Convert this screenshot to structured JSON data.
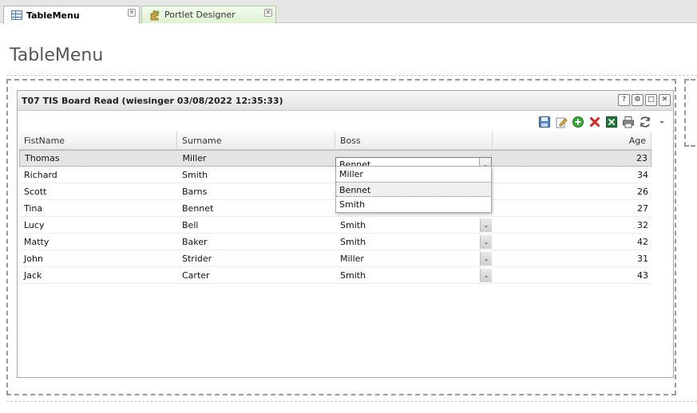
{
  "tabs": [
    {
      "label": "TableMenu",
      "active": true,
      "icon": "table-icon"
    },
    {
      "label": "Portlet Designer",
      "active": false,
      "icon": "puzzle-icon"
    }
  ],
  "page": {
    "title": "TableMenu"
  },
  "portlet": {
    "title": "T07 TIS Board Read (wiesinger 03/08/2022 12:35:33)",
    "header_buttons": [
      "?",
      "⚙",
      "□",
      "✕"
    ],
    "toolbar": [
      "save-icon",
      "edit-icon",
      "add-icon",
      "delete-icon",
      "excel-icon",
      "print-icon",
      "refresh-icon",
      "menu-arrow-icon"
    ]
  },
  "grid": {
    "columns": [
      "FistName",
      "Surname",
      "Boss",
      "Age"
    ],
    "rows": [
      {
        "first": "Thomas",
        "surname": "Miller",
        "boss": "Bennet",
        "age": "23"
      },
      {
        "first": "Richard",
        "surname": "Smith",
        "boss": "",
        "age": "34"
      },
      {
        "first": "Scott",
        "surname": "Barns",
        "boss": "",
        "age": "26"
      },
      {
        "first": "Tina",
        "surname": "Bennet",
        "boss": "",
        "age": "27"
      },
      {
        "first": "Lucy",
        "surname": "Bell",
        "boss": "Smith",
        "age": "32"
      },
      {
        "first": "Matty",
        "surname": "Baker",
        "boss": "Smith",
        "age": "42"
      },
      {
        "first": "John",
        "surname": "Strider",
        "boss": "Miller",
        "age": "31"
      },
      {
        "first": "Jack",
        "surname": "Carter",
        "boss": "Smith",
        "age": "43"
      }
    ],
    "editor": {
      "value": "Bennet",
      "options": [
        "Miller",
        "Bennet",
        "Smith"
      ],
      "highlighted": "Bennet"
    }
  }
}
